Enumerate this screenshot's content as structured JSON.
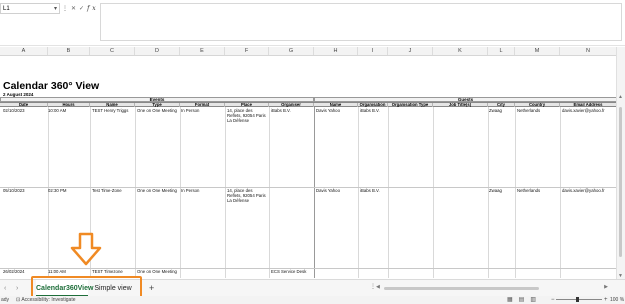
{
  "formula_bar": {
    "name_box": "L1",
    "icons": [
      "more-icon",
      "cancel-icon",
      "confirm-icon"
    ],
    "fx": "fx",
    "content": ""
  },
  "columns": [
    "A",
    "B",
    "C",
    "D",
    "E",
    "F",
    "G",
    "H",
    "I",
    "J",
    "K",
    "L",
    "M",
    "N"
  ],
  "report": {
    "title": "Calendar 360° View",
    "date": "2 August 2024",
    "group_events": "Events",
    "group_guests": "Guests",
    "headers": [
      "Date",
      "Hours",
      "Name",
      "Type",
      "Format",
      "Place",
      "Organiser",
      "Name",
      "Organisation",
      "Organisation Type",
      "Job Title(s)",
      "City",
      "Country",
      "Email Address"
    ]
  },
  "rows": [
    {
      "date": "02/10/2023",
      "hours": "10:00 AM",
      "name": "TEST Henry Triggs",
      "type": "One on One Meeting",
      "format": "In Person",
      "place": "14, place des Reflets, 92054 Paris La Défense",
      "organiser": "iBabs B.V.",
      "guest_name": "Davis Yahoo",
      "organisation": "iBabs B.V.",
      "org_type": "",
      "job_title": "",
      "city": "Zwaag",
      "country": "Netherlands",
      "email": "davis.xavier@yahoo.fr"
    },
    {
      "date": "05/10/2023",
      "hours": "02:30 PM",
      "name": "Test Time-Zone",
      "type": "One on One Meeting",
      "format": "In Person",
      "place": "14, place des Reflets, 92054 Paris La Défense",
      "organiser": "",
      "guest_name": "Davis Yahoo",
      "organisation": "iBabs B.V.",
      "org_type": "",
      "job_title": "",
      "city": "Zwaag",
      "country": "Netherlands",
      "email": "davis.xavier@yahoo.fr"
    },
    {
      "date": "26/02/2024",
      "hours": "11:00 AM",
      "name": "TEST Timezone",
      "type": "One on One Meeting",
      "format": "",
      "place": "",
      "organiser": "ECS Service Desk",
      "guest_name": "",
      "organisation": "",
      "org_type": "",
      "job_title": "",
      "city": "",
      "country": "",
      "email": ""
    }
  ],
  "tabs": {
    "active": "Calendar360View",
    "other": "Simple view",
    "add": "+"
  },
  "status": {
    "left": "ady",
    "accessibility": "Accessibility: Investigate",
    "zoom": "100 %"
  },
  "colors": {
    "highlight": "#f08a24",
    "active_tab": "#1e6e3a"
  }
}
